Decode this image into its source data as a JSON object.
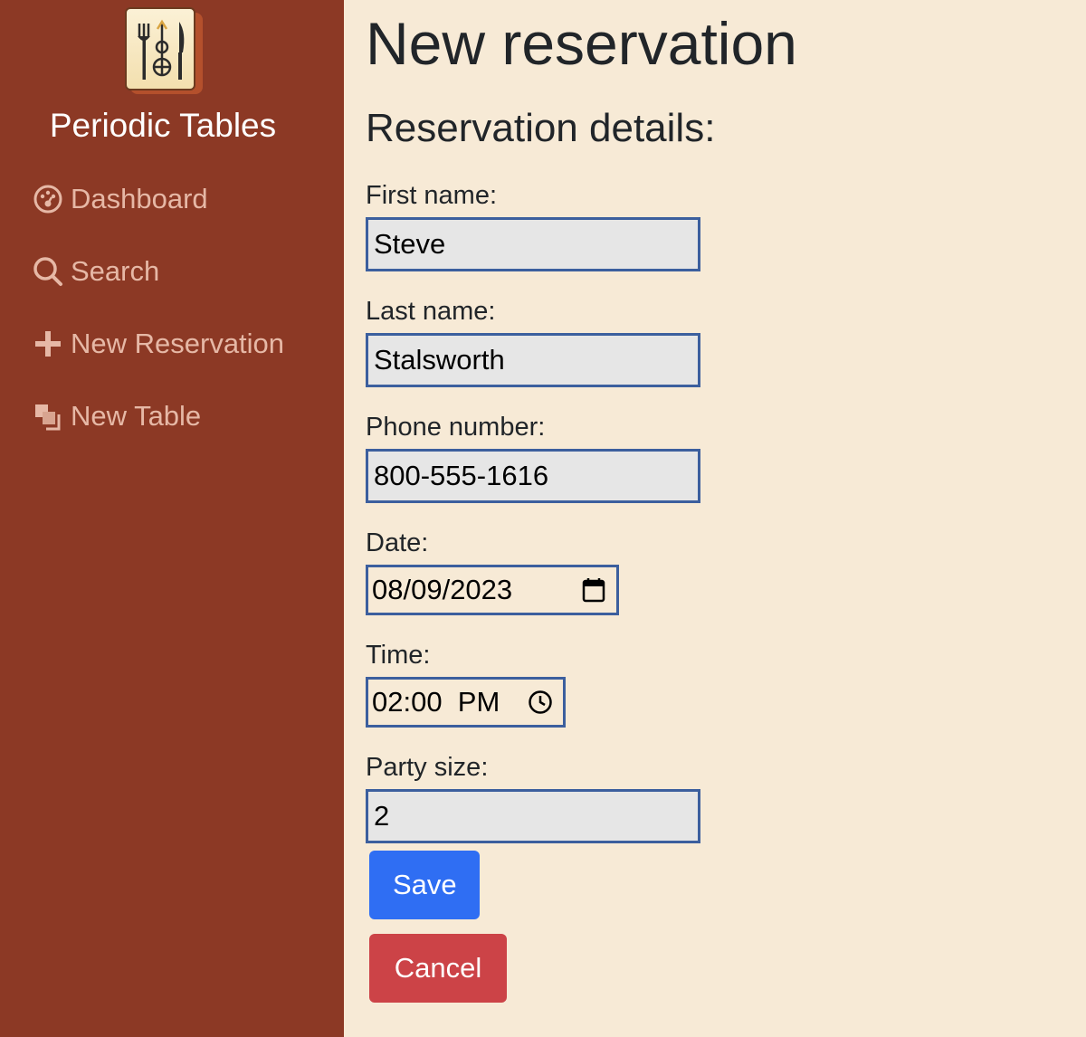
{
  "sidebar": {
    "brand": "Periodic Tables",
    "logo_icon": "fork-knife-logo-icon",
    "nav": [
      {
        "label": "Dashboard",
        "icon": "dashboard-icon"
      },
      {
        "label": "Search",
        "icon": "search-icon"
      },
      {
        "label": "New Reservation",
        "icon": "plus-icon"
      },
      {
        "label": "New Table",
        "icon": "layers-icon"
      }
    ]
  },
  "main": {
    "title": "New reservation",
    "subtitle": "Reservation details:",
    "fields": {
      "first_name": {
        "label": "First name:",
        "value": "Steve"
      },
      "last_name": {
        "label": "Last name:",
        "value": "Stalsworth"
      },
      "phone": {
        "label": "Phone number:",
        "value": "800-555-1616"
      },
      "date": {
        "label": "Date:",
        "value": "08/09/2023",
        "icon": "calendar-icon"
      },
      "time": {
        "label": "Time:",
        "value": "02:00  PM",
        "icon": "clock-icon"
      },
      "party_size": {
        "label": "Party size:",
        "value": "2"
      }
    },
    "buttons": {
      "save": "Save",
      "cancel": "Cancel"
    }
  },
  "colors": {
    "sidebar_bg": "#8c3925",
    "page_bg": "#f7ead6",
    "nav_text": "#e6b8a6",
    "field_border": "#3c5f9e",
    "save": "#2f6ef3",
    "cancel": "#cc4347"
  }
}
